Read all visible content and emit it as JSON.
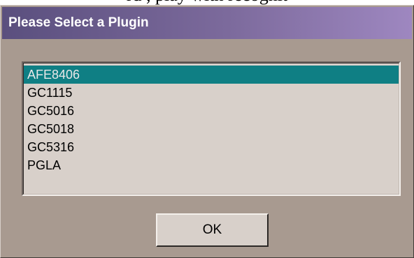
{
  "above_fragment": "rd                  , play with recognit",
  "dialog": {
    "title": "Please Select a Plugin",
    "plugins": [
      {
        "label": "AFE8406",
        "selected": true
      },
      {
        "label": "GC1115",
        "selected": false
      },
      {
        "label": "GC5016",
        "selected": false
      },
      {
        "label": "GC5018",
        "selected": false
      },
      {
        "label": "GC5316",
        "selected": false
      },
      {
        "label": "PGLA",
        "selected": false
      }
    ],
    "ok_label": "OK"
  },
  "colors": {
    "dialog_bg": "#a89a90",
    "titlebar_start": "#5a4f7e",
    "titlebar_end": "#9e87c0",
    "list_bg": "#d8d0ca",
    "selection": "#0f7f84"
  }
}
